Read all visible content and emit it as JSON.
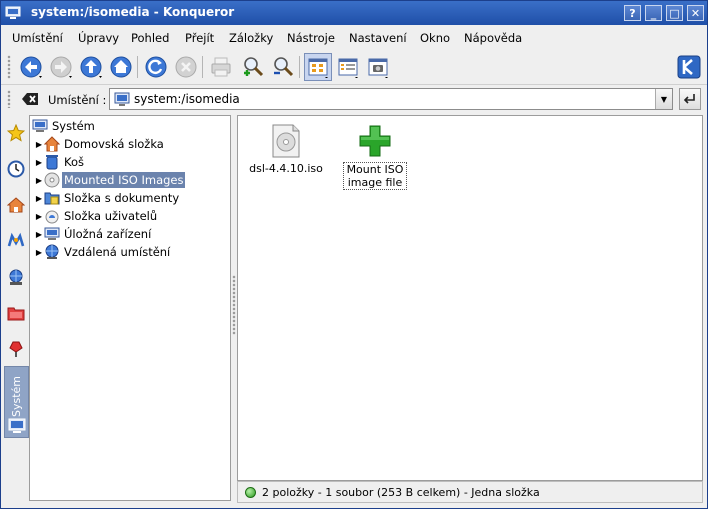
{
  "window": {
    "title": "system:/isomedia - Konqueror"
  },
  "titlebar_buttons": {
    "help": "?",
    "minimize": "_",
    "maximize": "□",
    "close": "✕"
  },
  "menu": [
    {
      "label": "Umístění"
    },
    {
      "label": "Úpravy"
    },
    {
      "label": "Pohled"
    },
    {
      "label": "Přejít"
    },
    {
      "label": "Záložky"
    },
    {
      "label": "Nástroje"
    },
    {
      "label": "Nastavení"
    },
    {
      "label": "Okno"
    },
    {
      "label": "Nápověda"
    }
  ],
  "toolbar": {
    "icons": [
      "back-icon",
      "forward-icon",
      "up-icon",
      "home-icon",
      "reload-icon",
      "stop-icon",
      "print-icon",
      "zoom-in-icon",
      "zoom-out-icon",
      "icon-view-icon",
      "detail-view-icon",
      "preview-icon"
    ],
    "brand_icon": "kde-logo"
  },
  "location": {
    "label": "Umístění :",
    "url": "system:/isomedia"
  },
  "sidebar_tabs": {
    "icons": [
      "bookmarks-icon",
      "history-icon",
      "home-folder-icon",
      "media-icon",
      "network-icon",
      "root-folder-icon",
      "services-icon",
      "system-icon"
    ],
    "active_label": "Systém"
  },
  "tree": {
    "root": "Systém",
    "items": [
      {
        "label": "Domovská složka",
        "icon": "home-icon"
      },
      {
        "label": "Koš",
        "icon": "trash-icon"
      },
      {
        "label": "Mounted ISO Images",
        "icon": "cdrom-icon",
        "selected": true
      },
      {
        "label": "Složka s dokumenty",
        "icon": "documents-folder-icon"
      },
      {
        "label": "Složka uživatelů",
        "icon": "users-icon"
      },
      {
        "label": "Úložná zařízení",
        "icon": "storage-icon"
      },
      {
        "label": "Vzdálená umístění",
        "icon": "network-icon"
      }
    ]
  },
  "files": [
    {
      "name": "dsl-4.4.10.iso",
      "icon": "iso-file-icon"
    },
    {
      "name": "Mount ISO image file",
      "icon": "add-plus-icon"
    }
  ],
  "status": {
    "text": "2 položky - 1 soubor (253 B celkem) - Jedna složka"
  },
  "colors": {
    "titlebar": "#2b5cb8",
    "selection": "#6b83ad",
    "plus_green": "#2aa52a"
  }
}
